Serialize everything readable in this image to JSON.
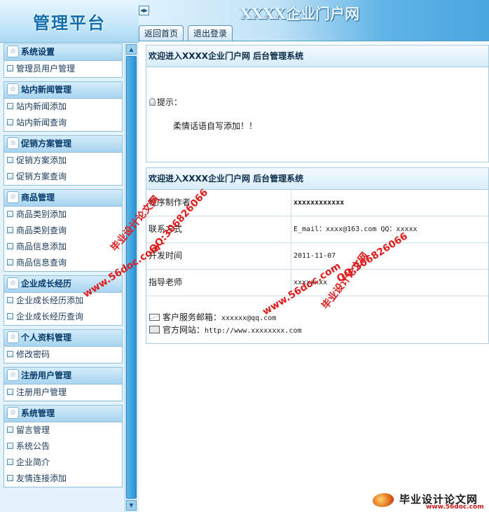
{
  "brand": {
    "title": "管理平台"
  },
  "header": {
    "site_title": "XXXX企业门户网",
    "collapse_glyph": "◂▸"
  },
  "tabs": [
    {
      "label": "返回首页"
    },
    {
      "label": "退出登录"
    }
  ],
  "menu": [
    {
      "title": "系统设置",
      "items": [
        "管理员用户管理"
      ]
    },
    {
      "title": "站内新闻管理",
      "items": [
        "站内新闻添加",
        "站内新闻查询"
      ]
    },
    {
      "title": "促销方案管理",
      "items": [
        "促销方案添加",
        "促销方案查询"
      ]
    },
    {
      "title": "商品管理",
      "items": [
        "商品类别添加",
        "商品类别查询",
        "商品信息添加",
        "商品信息查询"
      ]
    },
    {
      "title": "企业成长经历",
      "items": [
        "企业成长经历添加",
        "企业成长经历查询"
      ]
    },
    {
      "title": "个人资料管理",
      "items": [
        "修改密码"
      ]
    },
    {
      "title": "注册用户管理",
      "items": [
        "注册用户管理"
      ]
    },
    {
      "title": "系统管理",
      "items": [
        "留言管理",
        "系统公告",
        "企业简介",
        "友情连接添加"
      ]
    }
  ],
  "welcome": {
    "title": "欢迎进入XXXX企业门户网 后台管理系统",
    "tip_label": "提示：",
    "tip_text": "柔情话语自写添加！！"
  },
  "info": {
    "title": "欢迎进入XXXX企业门户网 后台管理系统",
    "rows": [
      {
        "label": "程序制作者",
        "value": "xxxxxxxxxxxx"
      },
      {
        "label": "联系方式",
        "value": "E_mail：xxxx@163.com QQ：xxxxx"
      },
      {
        "label": "开发时间",
        "value": "2011-11-07"
      },
      {
        "label": "指导老师",
        "value": "xxxxxxxx"
      }
    ],
    "email_label": "客户服务邮箱：",
    "email_value": "xxxxxx@qq.com",
    "site_label": "官方网站：",
    "site_value": "http://www.xxxxxxxx.com"
  },
  "watermarks": {
    "brand": "毕业设计论文网",
    "url": "www.56doc.com",
    "qq": "QQ:306826066",
    "bottom_brand": "毕业设计论文网",
    "bottom_url": "www.56doc.com"
  },
  "colors": {
    "accent": "#0f6eb2",
    "panel_border": "#a6cbe3",
    "watermark": "#e01b1b",
    "scroll_thumb": "#3aa0dd"
  }
}
